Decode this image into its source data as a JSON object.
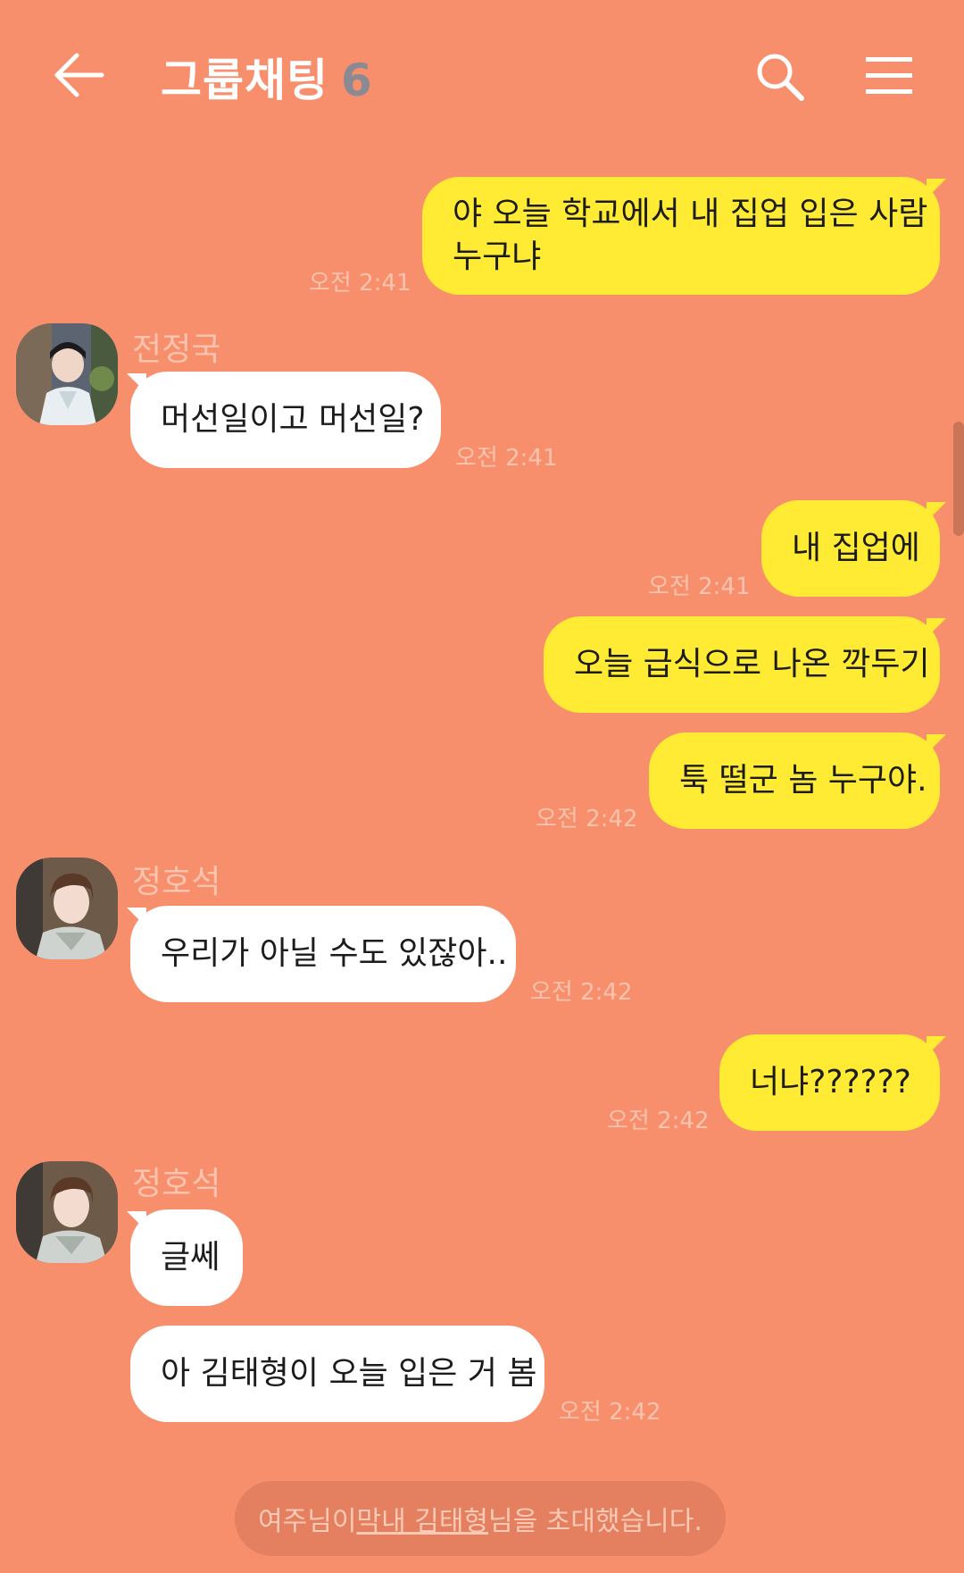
{
  "header": {
    "title": "그룹채팅",
    "member_count": "6",
    "back_icon": "back-arrow-icon",
    "search_icon": "search-icon",
    "menu_icon": "hamburger-menu-icon"
  },
  "colors": {
    "background": "#F78F6C",
    "my_bubble": "#FFEB33",
    "other_bubble": "#FFFFFF",
    "time_text": "#FCC3AF"
  },
  "messages": [
    {
      "from": "me",
      "lines": [
        "야 오늘 학교에서 내 집업 입은 사람",
        "누구냐"
      ],
      "time": "오전 2:41"
    },
    {
      "from": "전정국",
      "sender_label": "전정국",
      "text": "머선일이고 머선일?",
      "time": "오전 2:41"
    },
    {
      "from": "me",
      "text": "내 집업에",
      "time": "오전 2:41"
    },
    {
      "from": "me",
      "text": "오늘 급식으로 나온 깍두기"
    },
    {
      "from": "me",
      "text": "툭 떨군 놈 누구야.",
      "time": "오전 2:42"
    },
    {
      "from": "정호석",
      "sender_label": "정호석",
      "text": "우리가 아닐 수도 있잖아..",
      "time": "오전 2:42"
    },
    {
      "from": "me",
      "text": "너냐??????",
      "time": "오전 2:42"
    },
    {
      "from": "정호석",
      "sender_label": "정호석",
      "text": "글쎄"
    },
    {
      "from": "정호석",
      "text": "아 김태형이 오늘 입은 거 봄",
      "time": "오전 2:42"
    }
  ],
  "system_notice": {
    "prefix": "여주님이 ",
    "highlight": "막내 김태형",
    "suffix": "님을 초대했습니다."
  }
}
